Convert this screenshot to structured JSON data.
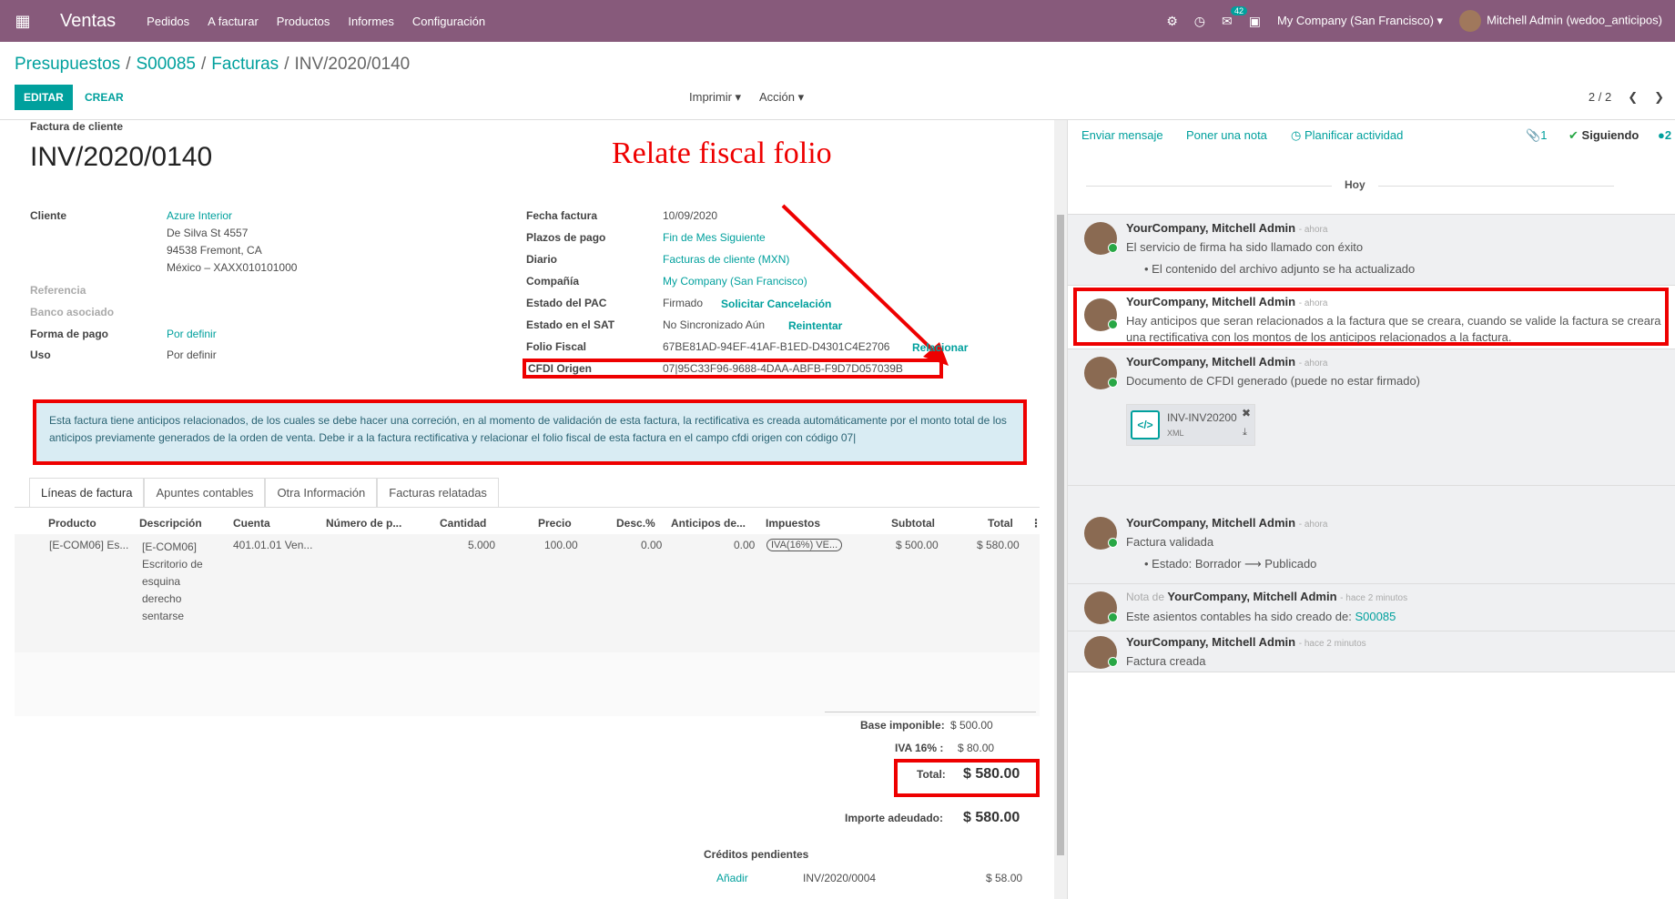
{
  "navbar": {
    "app": "Ventas",
    "menu": [
      "Pedidos",
      "A facturar",
      "Productos",
      "Informes",
      "Configuración"
    ],
    "msg_count": "42",
    "company": "My Company (San Francisco)",
    "user": "Mitchell Admin (wedoo_anticipos)"
  },
  "breadcrumb": [
    "Presupuestos",
    "S00085",
    "Facturas",
    "INV/2020/0140"
  ],
  "buttons": {
    "edit": "EDITAR",
    "create": "CREAR",
    "print": "Imprimir",
    "action": "Acción"
  },
  "pager": "2 / 2",
  "invoice": {
    "type_label": "Factura de cliente",
    "number": "INV/2020/0140",
    "annotation": "Relate fiscal folio",
    "left": {
      "cliente_label": "Cliente",
      "cliente": "Azure Interior",
      "addr1": "De Silva St 4557",
      "addr2": "94538 Fremont, CA",
      "addr3": "México – XAXX010101000",
      "referencia_label": "Referencia",
      "banco_label": "Banco asociado",
      "forma_label": "Forma de pago",
      "forma": "Por definir",
      "uso_label": "Uso",
      "uso": "Por definir"
    },
    "right": {
      "fecha_label": "Fecha factura",
      "fecha": "10/09/2020",
      "plazos_label": "Plazos de pago",
      "plazos": "Fin de Mes Siguiente",
      "diario_label": "Diario",
      "diario": "Facturas de cliente (MXN)",
      "compania_label": "Compañía",
      "compania": "My Company (San Francisco)",
      "pac_label": "Estado del PAC",
      "pac": "Firmado",
      "pac_action": "Solicitar Cancelación",
      "sat_label": "Estado en el SAT",
      "sat": "No Sincronizado Aún",
      "sat_action": "Reintentar",
      "folio_label": "Folio Fiscal",
      "folio": "67BE81AD-94EF-41AF-B1ED-D4301C4E2706",
      "folio_action": "Relacionar",
      "cfdi_label": "CFDI Origen",
      "cfdi": "07|95C33F96-9688-4DAA-ABFB-F9D7D057039B"
    },
    "alert": "Esta factura tiene anticipos relacionados, de los cuales se debe hacer una correción, en al momento de validación de esta factura, la rectificativa es creada automáticamente por el monto total de los anticipos previamente generados de la orden de venta. Debe ir a la factura rectificativa y relacionar el folio fiscal de esta factura en el campo cfdi origen con código 07|"
  },
  "tabs": [
    "Líneas de factura",
    "Apuntes contables",
    "Otra Información",
    "Facturas relatadas"
  ],
  "table": {
    "headers": [
      "Producto",
      "Descripción",
      "Cuenta",
      "Número de p...",
      "Cantidad",
      "Precio",
      "Desc.%",
      "Anticipos de...",
      "Impuestos",
      "Subtotal",
      "Total"
    ],
    "row": {
      "producto": "[E-COM06] Es...",
      "desc": [
        "[E-COM06]",
        "Escritorio de",
        "esquina",
        "derecho",
        "sentarse"
      ],
      "cuenta": "401.01.01 Ven...",
      "cantidad": "5.000",
      "precio": "100.00",
      "descuento": "0.00",
      "anticipos": "0.00",
      "impuestos": "IVA(16%) VE...",
      "subtotal": "$ 500.00",
      "total": "$ 580.00"
    }
  },
  "totals": {
    "base_label": "Base imponible:",
    "base": "$ 500.00",
    "iva_label": "IVA 16% :",
    "iva": "$ 80.00",
    "total_label": "Total:",
    "total": "$ 580.00",
    "adeudado_label": "Importe adeudado:",
    "adeudado": "$ 580.00",
    "creditos_label": "Créditos pendientes",
    "credit_action": "Añadir",
    "credit_ref": "INV/2020/0004",
    "credit_amount": "$ 58.00"
  },
  "chatter": {
    "send": "Enviar mensaje",
    "note": "Poner una nota",
    "activity": "Planificar actividad",
    "attachments": "1",
    "following": "Siguiendo",
    "followers": "2",
    "today": "Hoy",
    "messages": [
      {
        "author": "YourCompany, Mitchell Admin",
        "time": "- ahora",
        "body": "El servicio de firma ha sido llamado con éxito",
        "bullet": "El contenido del archivo adjunto se ha actualizado"
      },
      {
        "author": "YourCompany, Mitchell Admin",
        "time": "- ahora",
        "body": "Hay anticipos que seran relacionados a la factura que se creara, cuando se valide la factura se creara una rectificativa con los montos de los anticipos relacionados a la factura."
      },
      {
        "author": "YourCompany, Mitchell Admin",
        "time": "- ahora",
        "body": "Documento de CFDI generado (puede no estar firmado)",
        "attachment_name": "INV-INV20200",
        "attachment_type": "XML"
      },
      {
        "author": "YourCompany, Mitchell Admin",
        "time": "- ahora",
        "body": "Factura validada",
        "bullet": "Estado: Borrador ⟶ Publicado"
      },
      {
        "prefix": "Nota de",
        "author": "YourCompany, Mitchell Admin",
        "time": "- hace 2 minutos",
        "body": "Este asientos contables ha sido creado de:",
        "link": "S00085"
      },
      {
        "author": "YourCompany, Mitchell Admin",
        "time": "- hace 2 minutos",
        "body": "Factura creada"
      }
    ]
  }
}
